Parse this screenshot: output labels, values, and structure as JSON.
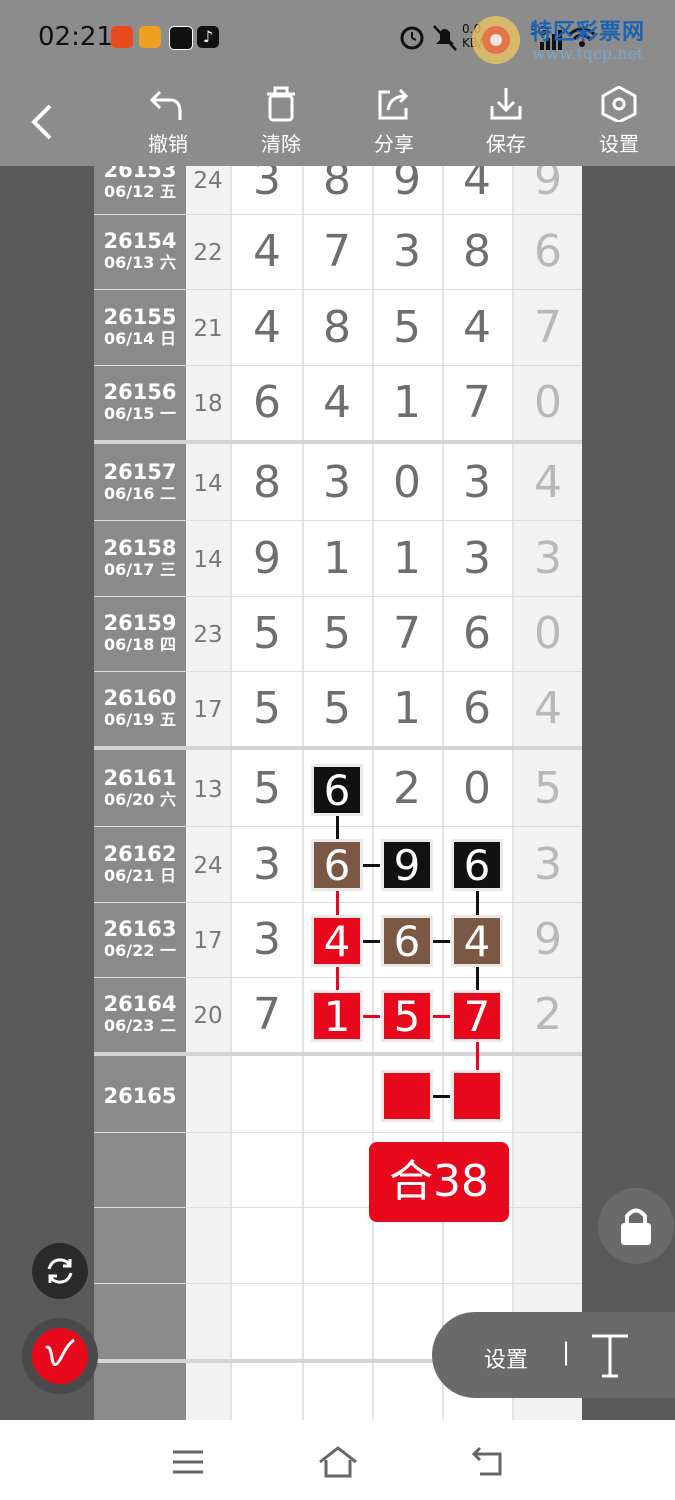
{
  "status_bar": {
    "time": "02:21",
    "net_speed_top": "0.0",
    "net_speed_bottom": "KB/",
    "signal_label": "5G"
  },
  "watermark": {
    "name": "特区彩票网",
    "url": "www.tqcp.net"
  },
  "toolbar": {
    "undo": "撤销",
    "clear": "清除",
    "share": "分享",
    "save": "保存",
    "settings": "设置"
  },
  "rows": [
    {
      "issue": "26153",
      "date": "06/12 五",
      "sum": "24",
      "digits": [
        "3",
        "8",
        "9",
        "4"
      ],
      "tail": "9"
    },
    {
      "issue": "26154",
      "date": "06/13 六",
      "sum": "22",
      "digits": [
        "4",
        "7",
        "3",
        "8"
      ],
      "tail": "6"
    },
    {
      "issue": "26155",
      "date": "06/14 日",
      "sum": "21",
      "digits": [
        "4",
        "8",
        "5",
        "4"
      ],
      "tail": "7"
    },
    {
      "issue": "26156",
      "date": "06/15 一",
      "sum": "18",
      "digits": [
        "6",
        "4",
        "1",
        "7"
      ],
      "tail": "0"
    },
    {
      "issue": "26157",
      "date": "06/16 二",
      "sum": "14",
      "digits": [
        "8",
        "3",
        "0",
        "3"
      ],
      "tail": "4"
    },
    {
      "issue": "26158",
      "date": "06/17 三",
      "sum": "14",
      "digits": [
        "9",
        "1",
        "1",
        "3"
      ],
      "tail": "3"
    },
    {
      "issue": "26159",
      "date": "06/18 四",
      "sum": "23",
      "digits": [
        "5",
        "5",
        "7",
        "6"
      ],
      "tail": "0"
    },
    {
      "issue": "26160",
      "date": "06/19 五",
      "sum": "17",
      "digits": [
        "5",
        "5",
        "1",
        "6"
      ],
      "tail": "4"
    },
    {
      "issue": "26161",
      "date": "06/20 六",
      "sum": "13",
      "digits": [
        "5",
        "6",
        "2",
        "0"
      ],
      "tail": "5"
    },
    {
      "issue": "26162",
      "date": "06/21 日",
      "sum": "24",
      "digits": [
        "3",
        "6",
        "9",
        "6"
      ],
      "tail": "3"
    },
    {
      "issue": "26163",
      "date": "06/22 一",
      "sum": "17",
      "digits": [
        "3",
        "4",
        "6",
        "4"
      ],
      "tail": "9"
    },
    {
      "issue": "26164",
      "date": "06/23 二",
      "sum": "20",
      "digits": [
        "7",
        "1",
        "5",
        "7"
      ],
      "tail": "2"
    },
    {
      "issue": "26165",
      "date": "",
      "sum": "",
      "digits": [
        "",
        "",
        "",
        ""
      ],
      "tail": ""
    }
  ],
  "sum_badge": "合38",
  "panel": {
    "settings": "设置",
    "separator": "|"
  },
  "colors": {
    "mark_black": "#111111",
    "mark_brown": "#7b5843",
    "mark_red": "#e8081c",
    "toolbar_bg": "#8c8c8c"
  }
}
